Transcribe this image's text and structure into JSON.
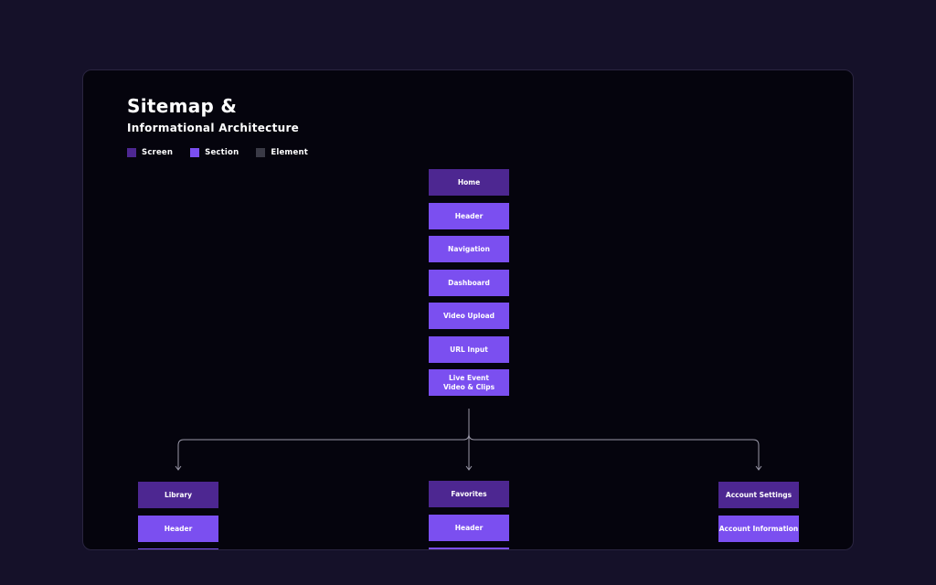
{
  "title": "Sitemap &",
  "subtitle": "Informational Architecture",
  "colors": {
    "screen": "#4d2791",
    "section": "#7b4ff0",
    "element": "#3a3a46",
    "connector": "#9a98a8"
  },
  "legend": [
    {
      "label": "Screen",
      "color": "#4d2791"
    },
    {
      "label": "Section",
      "color": "#7b4ff0"
    },
    {
      "label": "Element",
      "color": "#3a3a46"
    }
  ],
  "home_stack": [
    {
      "label": "Home",
      "kind": "screen"
    },
    {
      "label": "Header",
      "kind": "section"
    },
    {
      "label": "Navigation",
      "kind": "section"
    },
    {
      "label": "Dashboard",
      "kind": "section"
    },
    {
      "label": "Video Upload",
      "kind": "section"
    },
    {
      "label": "URL Input",
      "kind": "section"
    },
    {
      "label": "Live Event\nVideo & Clips",
      "kind": "section"
    }
  ],
  "library_stack": [
    {
      "label": "Library",
      "kind": "screen"
    },
    {
      "label": "Header",
      "kind": "section"
    }
  ],
  "favorites_stack": [
    {
      "label": "Favorites",
      "kind": "screen"
    },
    {
      "label": "Header",
      "kind": "section"
    }
  ],
  "account_stack": [
    {
      "label": "Account Settings",
      "kind": "screen"
    },
    {
      "label": "Account Information",
      "kind": "section"
    }
  ]
}
